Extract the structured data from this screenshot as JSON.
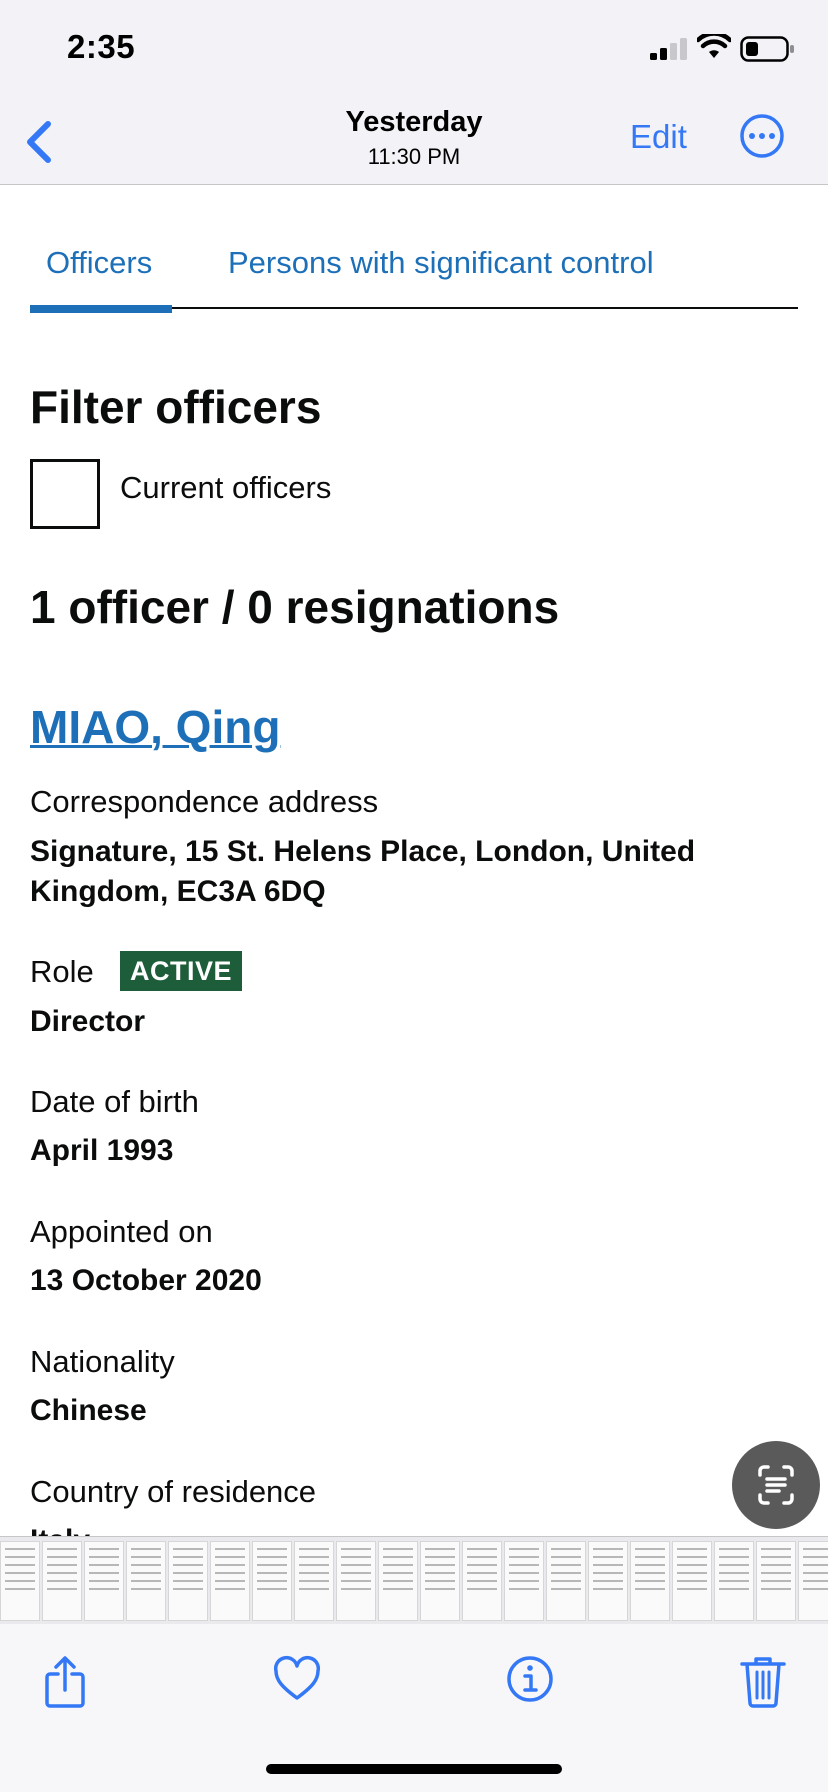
{
  "status": {
    "time": "2:35"
  },
  "nav": {
    "title": "Yesterday",
    "subtitle": "11:30 PM",
    "edit_label": "Edit"
  },
  "tabs": [
    {
      "label": "Officers",
      "active": true
    },
    {
      "label": "Persons with significant control",
      "active": false
    }
  ],
  "filter": {
    "heading": "Filter officers",
    "checkbox_label": "Current officers",
    "checked": false
  },
  "summary": "1 officer / 0 resignations",
  "officer": {
    "name": "MIAO, Qing",
    "address_label": "Correspondence address",
    "address_value": "Signature, 15 St. Helens Place, London, United Kingdom, EC3A 6DQ",
    "role_label": "Role",
    "status_badge": "ACTIVE",
    "role_value": "Director",
    "dob_label": "Date of birth",
    "dob_value": "April 1993",
    "appointed_label": "Appointed on",
    "appointed_value": "13 October 2020",
    "nationality_label": "Nationality",
    "nationality_value": "Chinese",
    "residence_label": "Country of residence",
    "residence_value": "Italy"
  },
  "colors": {
    "link": "#1d70b8",
    "ios_accent": "#3478f6",
    "badge": "#1e5d3a"
  },
  "toolbar_icons": [
    "share-icon",
    "heart-icon",
    "info-icon",
    "trash-icon"
  ]
}
